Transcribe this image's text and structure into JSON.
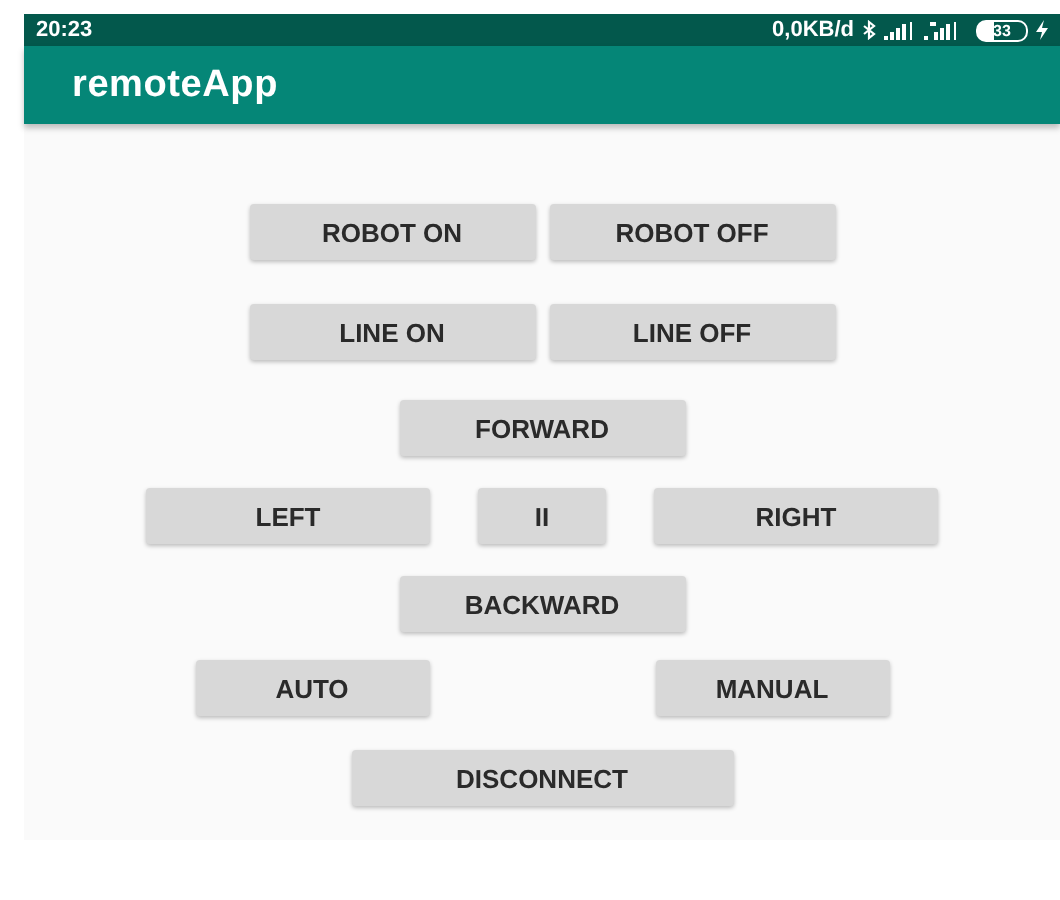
{
  "status_bar": {
    "time": "20:23",
    "speed": "0,0KB/d",
    "battery": "33"
  },
  "app_bar": {
    "title": "remoteApp"
  },
  "rows": [
    {
      "buttons": [
        "ROBOT ON",
        "ROBOT OFF"
      ]
    },
    {
      "buttons": [
        "LINE ON",
        "LINE OFF"
      ]
    },
    {
      "buttons": [
        "FORWARD"
      ]
    },
    {
      "buttons": [
        "LEFT",
        "II",
        "RIGHT"
      ]
    },
    {
      "buttons": [
        "BACKWARD"
      ]
    },
    {
      "buttons": [
        "AUTO",
        "MANUAL"
      ]
    },
    {
      "buttons": [
        "DISCONNECT"
      ]
    }
  ]
}
